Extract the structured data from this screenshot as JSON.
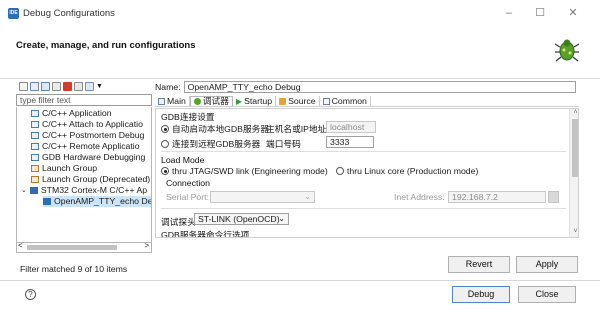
{
  "window": {
    "title": "Debug Configurations",
    "logo_text": "IDE",
    "minimize": "–",
    "maximize": "☐",
    "close": "✕"
  },
  "header": {
    "text": "Create, manage, and run configurations"
  },
  "left": {
    "filter_placeholder": "type filter text",
    "tree": [
      {
        "label": "C/C++ Application"
      },
      {
        "label": "C/C++ Attach to Applicatio"
      },
      {
        "label": "C/C++ Postmortem Debug"
      },
      {
        "label": "C/C++ Remote Applicatio"
      },
      {
        "label": "GDB Hardware Debugging"
      },
      {
        "label": "Launch Group"
      },
      {
        "label": "Launch Group (Deprecated)"
      },
      {
        "label": "STM32 Cortex-M C/C++ Ap"
      },
      {
        "label": "OpenAMP_TTY_echo Del"
      }
    ],
    "expand_toggle": "⌄",
    "scroll_left": "<",
    "scroll_right": ">",
    "status": "Filter matched 9 of 10 items"
  },
  "right": {
    "name_label": "Name:",
    "name_value": "OpenAMP_TTY_echo Debug",
    "tabs": [
      "Main",
      "调试器",
      "Startup",
      "Source",
      "Common"
    ],
    "gdb_section": "GDB连接设置",
    "radio_local": "自动启动本地GDB服务器",
    "host_label": "主机名或IP地址",
    "host_value": "localhost",
    "radio_remote": "连接到远程GDB服务器",
    "port_label": "端口号码",
    "port_value": "3333",
    "load_mode": "Load Mode",
    "jtag_option": "thru JTAG/SWD link (Engineering mode)",
    "linux_option": "thru Linux core (Production mode)",
    "connection": "Connection",
    "serial_label": "Serial Port:",
    "inet_label": "Inet Address:",
    "inet_value": "192.168.7.2",
    "probe_label": "调试探头",
    "probe_value": "ST-LINK (OpenOCD)",
    "gdb_options": "GDB服务器命令行选项",
    "scroll_up": "˄",
    "scroll_down": "˅"
  },
  "buttons": {
    "revert": "Revert",
    "apply": "Apply",
    "debug": "Debug",
    "close": "Close"
  },
  "help": "?"
}
